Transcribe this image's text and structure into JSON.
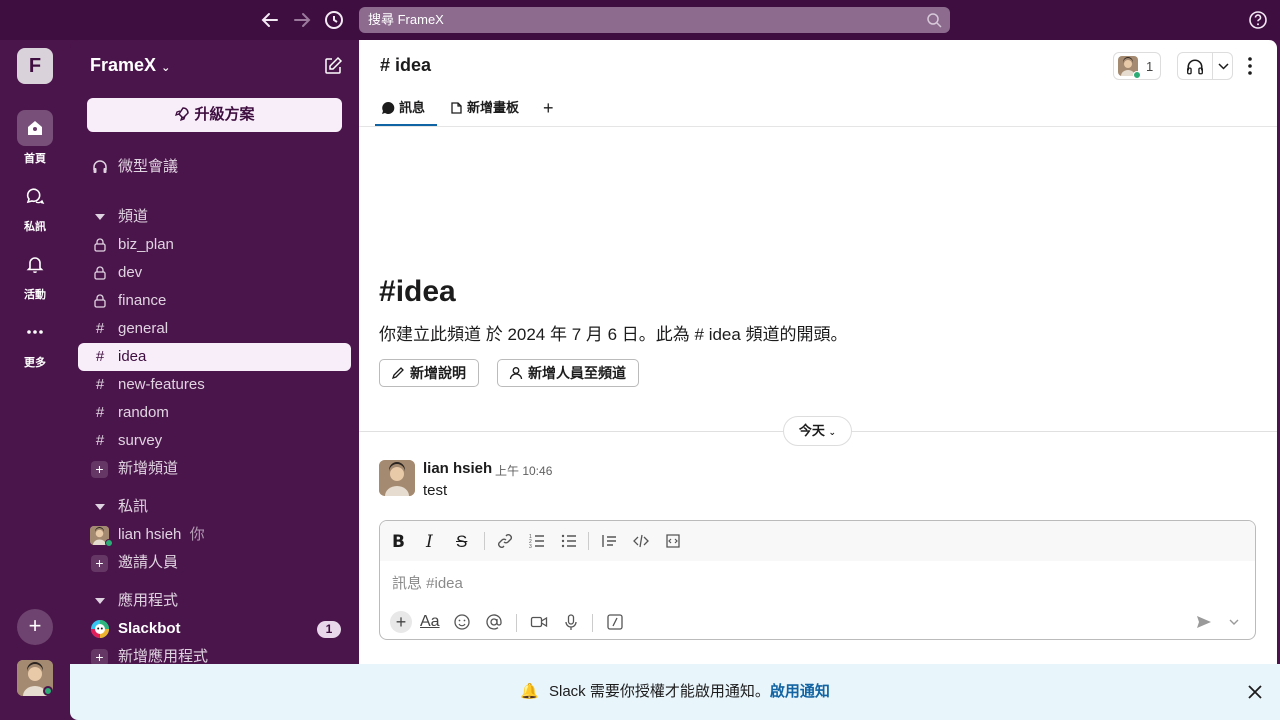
{
  "topbar": {
    "search_placeholder": "搜尋 FrameX",
    "icons": [
      "back-arrow-icon",
      "forward-arrow-icon",
      "history-clock-icon",
      "search-icon",
      "help-icon"
    ]
  },
  "rail": {
    "workspace_initial": "F",
    "items": [
      {
        "label": "首頁",
        "icon": "home-icon"
      },
      {
        "label": "私訊",
        "icon": "messages-icon"
      },
      {
        "label": "活動",
        "icon": "bell-icon"
      },
      {
        "label": "更多",
        "icon": "more-icon"
      }
    ]
  },
  "sidebar": {
    "workspace_name": "FrameX",
    "upgrade_label": "升級方案",
    "huddles_label": "微型會議",
    "channels_section": "頻道",
    "channels": [
      {
        "name": "biz_plan",
        "private": true
      },
      {
        "name": "dev",
        "private": true
      },
      {
        "name": "finance",
        "private": true
      },
      {
        "name": "general",
        "private": false
      },
      {
        "name": "idea",
        "private": false
      },
      {
        "name": "new-features",
        "private": false
      },
      {
        "name": "random",
        "private": false
      },
      {
        "name": "survey",
        "private": false
      }
    ],
    "add_channel": "新增頻道",
    "dm_section": "私訊",
    "dm_user": "lian hsieh",
    "dm_you": "你",
    "invite": "邀請人員",
    "apps_section": "應用程式",
    "slackbot": "Slackbot",
    "slackbot_badge": "1",
    "add_app": "新增應用程式"
  },
  "channel": {
    "header": "idea",
    "member_count": "1",
    "tabs": [
      {
        "label": "訊息",
        "icon": "message-bubble-icon"
      },
      {
        "label": "新增畫板",
        "icon": "canvas-icon"
      }
    ],
    "intro_title": "idea",
    "intro_text": "你建立此頻道 於 2024 年 7 月 6 日。此為 # idea 頻道的開頭。",
    "add_desc": "新增說明",
    "add_people": "新增人員至頻道",
    "day_divider": "今天"
  },
  "message": {
    "author": "lian hsieh",
    "time": "上午 10:46",
    "text": "test"
  },
  "composer": {
    "placeholder": "訊息 #idea",
    "format_text": "Aa"
  },
  "notification": {
    "text": "Slack 需要你授權才能啟用通知。",
    "link": "啟用通知",
    "bell": "🔔"
  },
  "colors": {
    "aubergine": "#4a154b",
    "topbar": "#3f0e40",
    "link": "#1264a3",
    "presence": "#2bac76"
  }
}
